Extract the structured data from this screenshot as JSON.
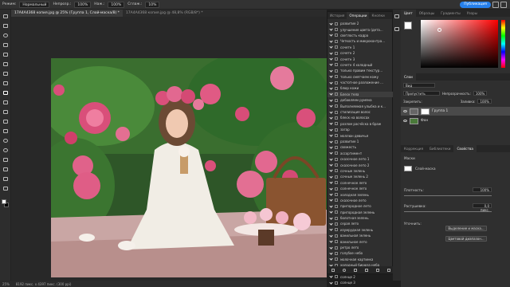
{
  "optionsbar": {
    "mode_label": "Режим:",
    "mode_value": "Нормальный",
    "opacity_label": "Непрозр.:",
    "opacity_value": "100%",
    "flow_label": "Наж.:",
    "flow_value": "100%",
    "smoothing_label": "Сглаж.:",
    "smoothing_value": "10%",
    "publish_label": "Публикация"
  },
  "doc_tabs": [
    "17A4A4368 копия.jpg @ 25% (Группа 1, Слой-маска/8) *",
    "17A4A4368 копия.jpg @ 48,8% (RGB/8*) *"
  ],
  "status": {
    "zoom": "25%",
    "size": "8192 пикс. x 4397 пикс. (300 ppi)"
  },
  "ops_panel": {
    "tabs": [
      "История",
      "Операции",
      "Кнопки"
    ],
    "active_tab": 1,
    "selected_index": 12,
    "items": [
      "развитие 2",
      "улучшение цвета (дета...",
      "светлость кадра",
      "Четкость и микроконтра...",
      "сочетн 1",
      "сочетн 2",
      "сочетн 3",
      "сочетн 4 холодный",
      "только правим текстур...",
      "только смягчаем кожу",
      "частотное разложение ...",
      "блюр кожи",
      "Блеск тела",
      "добавляем румяна",
      "Выполняемая улыбка и к...",
      "стилизация волос",
      "блеск на волосах",
      "разлом расчёска в браж",
      "загар",
      "моллюн девичья",
      "развитие 1",
      "свежесть",
      "ассортимент",
      "сказочное лето 1",
      "сказочное лето 2",
      "сочные зелень",
      "сочные зелень 2",
      "солнечное лето",
      "солнечное лето",
      "холодная зелень",
      "сказочное лето",
      "пригородное лето",
      "пригородная зелень",
      "болотная зелень",
      "серая лето",
      "изумрудная зелень",
      "ванильная зелень",
      "ванильное лето",
      "ретро лето",
      "голубое небо",
      "молочная картинка",
      "холодный бирюза неба",
      "солнце 1",
      "солнце 2",
      "солнце 3"
    ]
  },
  "right_panel": {
    "color_tabs": [
      "Цвет",
      "Образцы",
      "Градиенты",
      "Узоры"
    ],
    "layers_tabs": [
      "Слои"
    ],
    "search_placeholder": "Вид",
    "blend_mode": "Пропустить",
    "opacity_label": "Непрозрачность:",
    "opacity_value": "100%",
    "lock_label": "Закрепить:",
    "fill_label": "Заливка:",
    "fill_value": "100%",
    "layers": [
      {
        "name": "Группа 1",
        "selected": true
      },
      {
        "name": "Фон",
        "selected": false
      }
    ],
    "props_tabs": [
      "Коррекция",
      "Библиотеки",
      "Свойства"
    ],
    "props_title": "Маски",
    "mask_label": "Слой-маска",
    "density_label": "Плотность:",
    "density_value": "100%",
    "feather_label": "Растушевка:",
    "feather_value": "0,0 пикс.",
    "refine_label": "Уточнить:",
    "select_mask_btn": "Выделение и маска...",
    "color_range_btn": "Цветовой диапазон..."
  },
  "colors": {
    "accent": "#2680eb",
    "foreground": "#ffffff",
    "background": "#000000"
  }
}
